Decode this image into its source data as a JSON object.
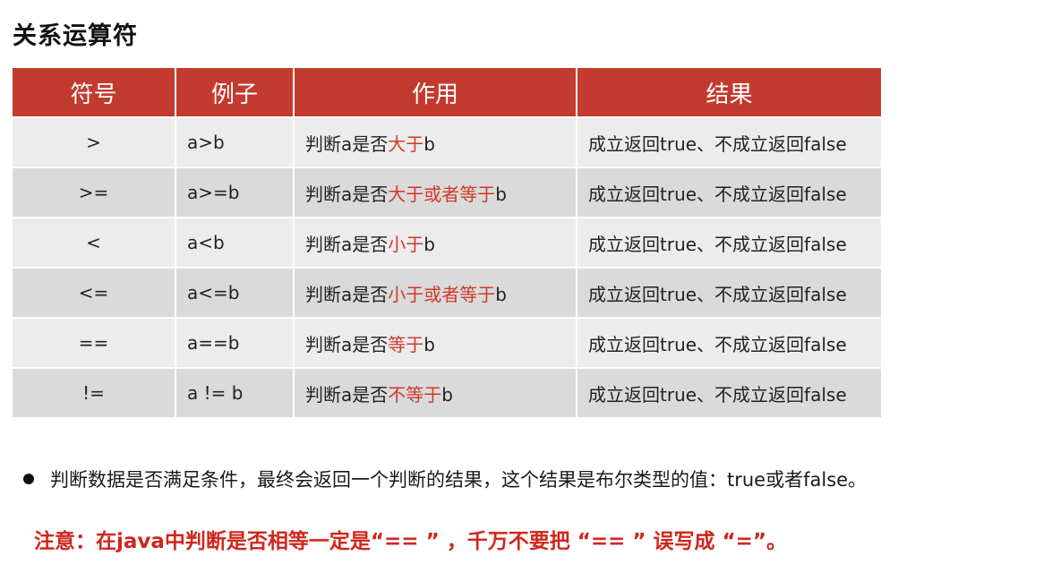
{
  "title": "关系运算符",
  "table": {
    "headers": [
      "符号",
      "例子",
      "作用",
      "结果"
    ],
    "rows": [
      {
        "symbol": ">",
        "example": "a>b",
        "action_prefix": "判断a是否",
        "action_highlight": "大于",
        "action_suffix": "b",
        "result": "成立返回true、不成立返回false"
      },
      {
        "symbol": ">=",
        "example": "a>=b",
        "action_prefix": "判断a是否",
        "action_highlight": "大于或者等于",
        "action_suffix": "b",
        "result": "成立返回true、不成立返回false"
      },
      {
        "symbol": "<",
        "example": "a<b",
        "action_prefix": "判断a是否",
        "action_highlight": "小于",
        "action_suffix": "b",
        "result": "成立返回true、不成立返回false"
      },
      {
        "symbol": "<=",
        "example": "a<=b",
        "action_prefix": "判断a是否",
        "action_highlight": "小于或者等于",
        "action_suffix": "b",
        "result": "成立返回true、不成立返回false"
      },
      {
        "symbol": "==",
        "example": "a==b",
        "action_prefix": "判断a是否",
        "action_highlight": "等于",
        "action_suffix": "b",
        "result": "成立返回true、不成立返回false"
      },
      {
        "symbol": "!=",
        "example": "a != b",
        "action_prefix": "判断a是否",
        "action_highlight": "不等于",
        "action_suffix": "b",
        "result": "成立返回true、不成立返回false"
      }
    ]
  },
  "bullet_text": "判断数据是否满足条件，最终会返回一个判断的结果，这个结果是布尔类型的值：true或者false。",
  "note_text": "注意：在java中判断是否相等一定是“== ” ，千万不要把 “== ” 误写成 “=”。",
  "colors": {
    "header_bg": "#c33a2e",
    "highlight": "#d0392b",
    "note": "#d0261c"
  }
}
